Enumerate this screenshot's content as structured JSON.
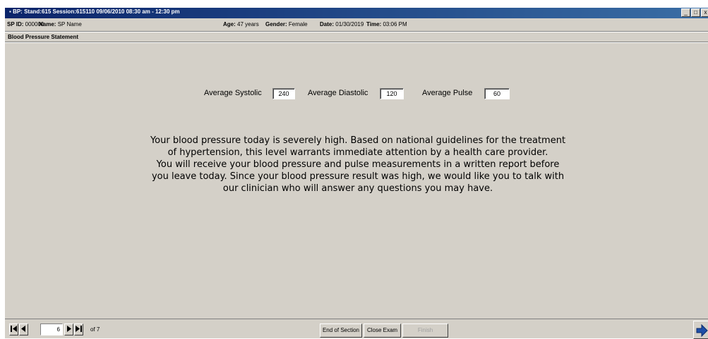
{
  "window": {
    "title": "BP: Stand:615 Session:615110 09/06/2010 08:30 am - 12:30 pm",
    "controls": [
      "_",
      "□",
      "x"
    ]
  },
  "info": {
    "sp_id_label": "SP ID:",
    "sp_id_value": "000000",
    "name_label": "Name:",
    "name_value": "SP Name",
    "age_label": "Age:",
    "age_value": "47 years",
    "gender_label": "Gender:",
    "gender_value": "Female",
    "date_label": "Date:",
    "date_value": "01/30/2019",
    "time_label": "Time:",
    "time_value": "03:06 PM"
  },
  "section_title": "Blood Pressure Statement",
  "readings": {
    "systolic_label": "Average Systolic",
    "systolic_value": "240",
    "diastolic_label": "Average Diastolic",
    "diastolic_value": "120",
    "pulse_label": "Average Pulse",
    "pulse_value": "60"
  },
  "message": [
    "Your blood pressure today is severely high.  Based on national guidelines for the treatment",
    "of hypertension, this level warrants immediate attention by a health care provider.",
    "You will receive your blood pressure and pulse measurements in a written report before",
    "you leave today.  Since your blood pressure result was high, we would like you to talk with",
    "our clinician who will answer any questions you may have."
  ],
  "navigation": {
    "current_page": "6",
    "total_pages": "of 7"
  },
  "buttons": {
    "end_of_section": "End of Section",
    "close_exam": "Close Exam",
    "finish": "Finish"
  }
}
